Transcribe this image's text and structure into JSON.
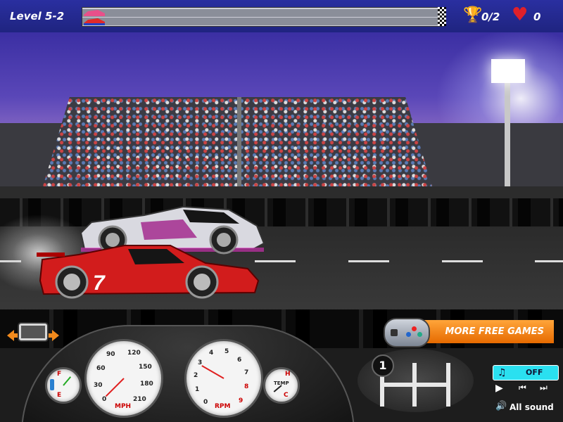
{
  "hud": {
    "level": "Level 5-2",
    "trophies": "0/2",
    "lives": "0",
    "icons": [
      "trophy-icon",
      "heart-icon",
      "checkered-flag-icon"
    ]
  },
  "progress": {
    "player_fraction": 0.0,
    "opponent_fraction": 0.0
  },
  "cars": [
    {
      "name": "opponent-car",
      "color": "#d9d9e0",
      "accent": "#b0208a"
    },
    {
      "name": "player-car",
      "color": "#d21c1c",
      "number": "7"
    }
  ],
  "dashboard": {
    "fuel": {
      "top": "F",
      "bottom": "E",
      "level": 0.6
    },
    "speedometer": {
      "ticks": [
        "0",
        "30",
        "60",
        "90",
        "120",
        "150",
        "180",
        "210"
      ],
      "unit": "MPH",
      "value": 0
    },
    "tachometer": {
      "ticks": [
        "0",
        "1",
        "2",
        "3",
        "4",
        "5",
        "6",
        "7",
        "8",
        "9"
      ],
      "unit": "RPM",
      "value": 2.5
    },
    "temp": {
      "top": "H",
      "bottom": "C",
      "label": "TEMP",
      "level": 0.5
    },
    "gear": "1"
  },
  "menu": {
    "more_games": "MORE FREE GAMES",
    "music_state": "OFF",
    "all_sound": "All sound",
    "icons": [
      "music-note-icon",
      "play-icon",
      "previous-icon",
      "next-icon",
      "speaker-icon"
    ]
  },
  "colors": {
    "accent": "#f28a1c",
    "music_button": "#2ae0f0"
  }
}
